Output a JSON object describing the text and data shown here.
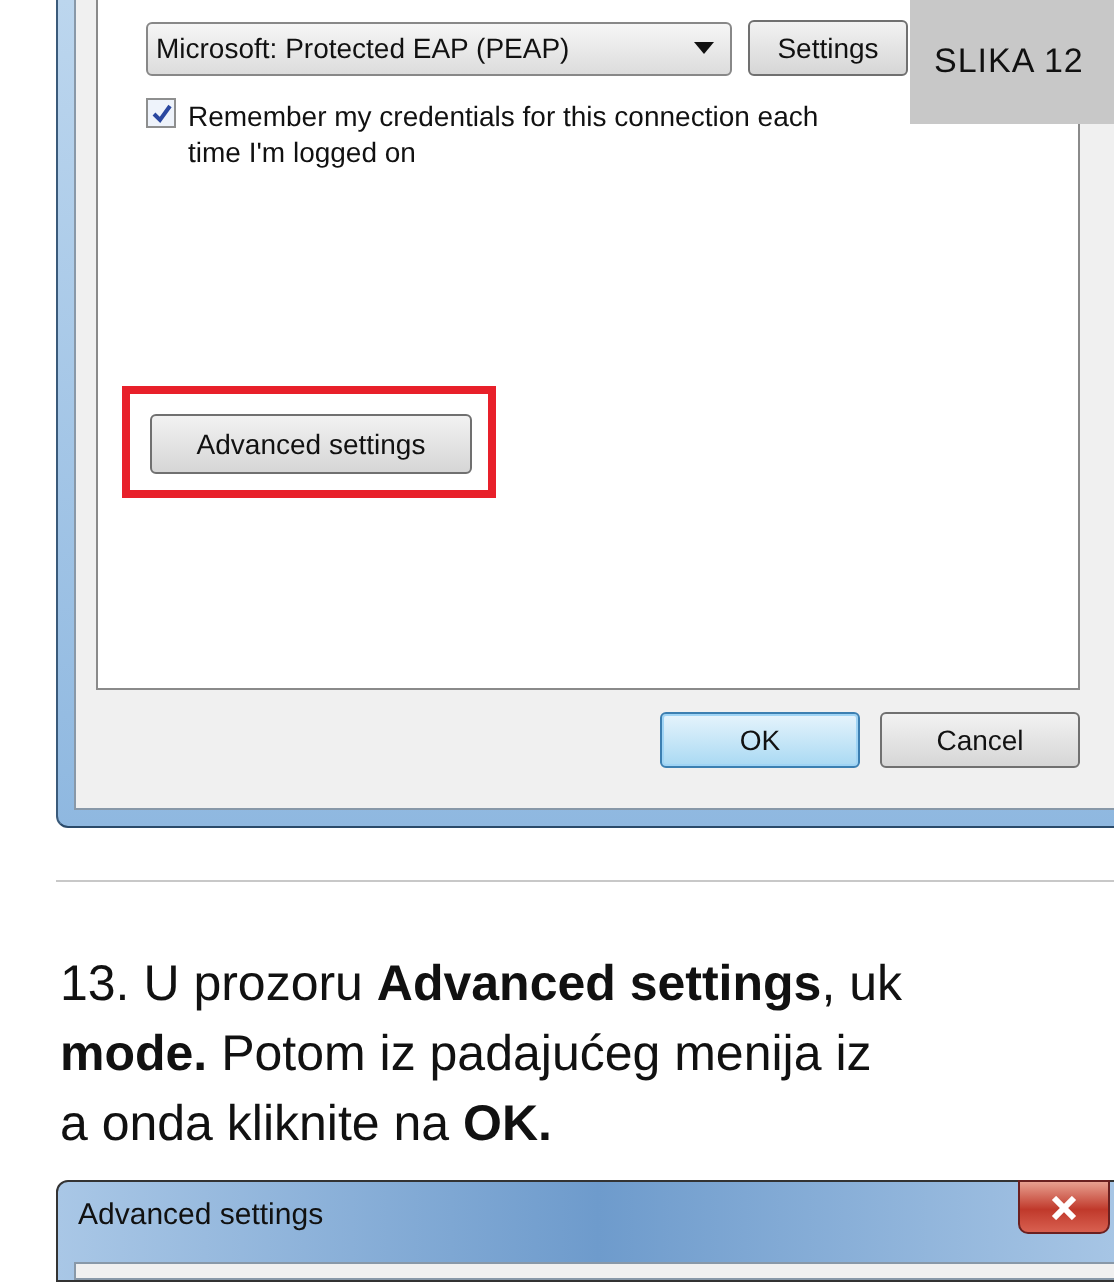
{
  "caption": "SLIKA 12",
  "dialog": {
    "auth_method": {
      "value": "Microsoft: Protected EAP (PEAP)"
    },
    "settings_button": "Settings",
    "remember": {
      "label": "Remember my credentials for this connection each time I'm logged on",
      "checked": true
    },
    "advanced_button": {
      "label": "Advanced settings",
      "highlighted": true
    },
    "buttons": [
      {
        "label": "OK",
        "default": true
      },
      {
        "label": "Cancel",
        "default": false
      }
    ]
  },
  "instructions": [
    "13. U prozoru **Advanced settings**, uk",
    "**mode.** Potom iz padajućeg menija iz",
    "a onda kliknite na **OK.**"
  ],
  "second_dialog": {
    "title": "Advanced settings"
  }
}
